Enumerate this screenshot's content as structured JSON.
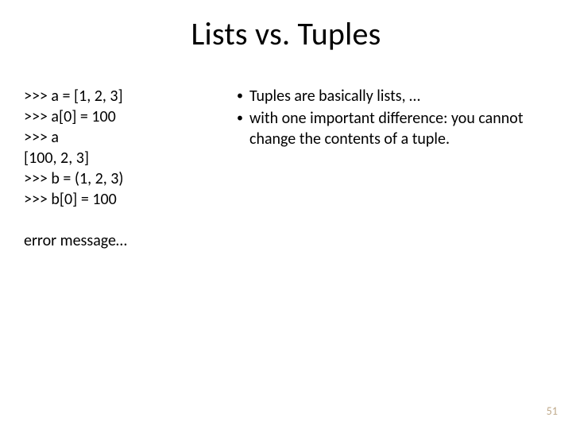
{
  "title": "Lists vs. Tuples",
  "code": {
    "lines": [
      ">>> a = [1, 2, 3]",
      ">>> a[0] = 100",
      ">>> a",
      "[100, 2, 3]",
      ">>> b = (1, 2, 3)",
      ">>> b[0] = 100"
    ],
    "error": "error message…"
  },
  "bullets": [
    "Tuples are basically lists, …",
    "with one important difference: you cannot change the contents of a tuple."
  ],
  "page_number": "51"
}
